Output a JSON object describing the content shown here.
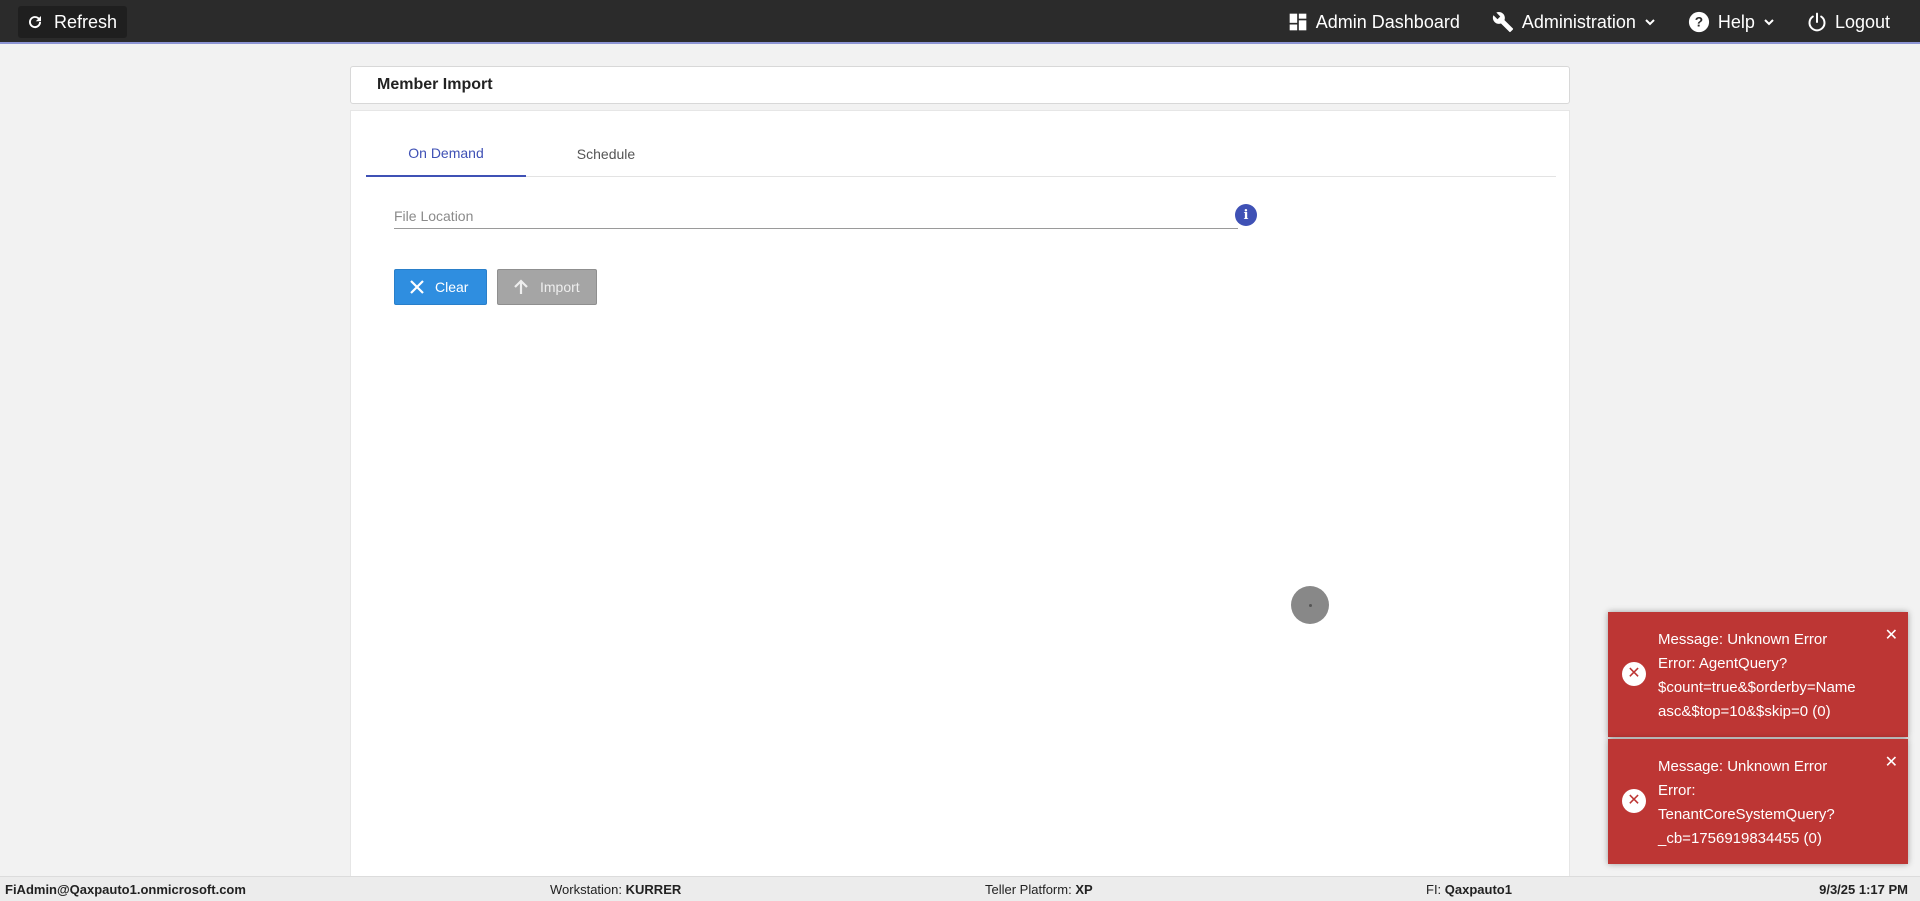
{
  "topbar": {
    "refresh_label": "Refresh",
    "nav": {
      "admin_dashboard": "Admin Dashboard",
      "administration": "Administration",
      "help": "Help",
      "logout": "Logout"
    }
  },
  "page": {
    "title": "Member Import",
    "tabs": [
      "On Demand",
      "Schedule"
    ],
    "active_tab": "On Demand",
    "file_location_placeholder": "File Location",
    "info_icon_text": "i",
    "clear_label": "Clear",
    "import_label": "Import"
  },
  "toasts": [
    {
      "lines": [
        "Message: Unknown Error",
        "Error: AgentQuery?",
        "$count=true&$orderby=Name",
        "asc&$top=10&$skip=0 (0)"
      ]
    },
    {
      "lines": [
        "Message: Unknown Error",
        "Error:",
        "TenantCoreSystemQuery?",
        "_cb=1756919834455 (0)"
      ]
    }
  ],
  "footer": {
    "user": "FiAdmin@Qaxpauto1.onmicrosoft.com",
    "workstation_label": "Workstation:",
    "workstation_value": "KURRER",
    "teller_label": "Teller Platform:",
    "teller_value": "XP",
    "fi_label": "FI:",
    "fi_value": "Qaxpauto1",
    "datetime": "9/3/25 1:17 PM"
  },
  "colors": {
    "topbar_bg": "#2b2b2b",
    "accent": "#3f51b5",
    "clear_button": "#2f8ee0",
    "import_button_disabled": "#a5a5a5",
    "toast_error": "#bd3634"
  },
  "icons": {
    "refresh": "refresh-icon",
    "admin_dashboard": "dashboard-icon",
    "administration": "wrench-icon",
    "help": "help-circle-icon",
    "logout": "power-icon",
    "clear": "close-icon",
    "import": "arrow-up-icon",
    "info": "info-icon",
    "toast_error": "error-circle-icon",
    "toast_close": "close-icon"
  }
}
